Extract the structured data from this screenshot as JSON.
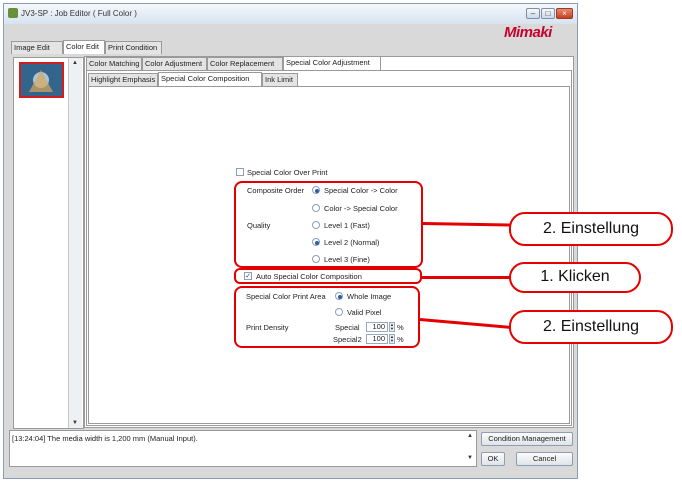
{
  "window": {
    "title": "JV3-SP : Job Editor ( Full Color )",
    "controls": [
      "–",
      "□",
      "×"
    ]
  },
  "logo": "Mimaki",
  "main_tabs": [
    {
      "label": "Image Edit"
    },
    {
      "label": "Color Edit"
    },
    {
      "label": "Print Condition"
    }
  ],
  "sub_tabs": [
    {
      "label": "Color Matching"
    },
    {
      "label": "Color Adjustment"
    },
    {
      "label": "Color Replacement"
    },
    {
      "label": "Special Color Adjustment"
    }
  ],
  "inner_tabs": [
    {
      "label": "Highlight Emphasis"
    },
    {
      "label": "Special Color Composition"
    },
    {
      "label": "Ink Limit"
    }
  ],
  "form": {
    "over_print": {
      "label": "Special Color Over Print",
      "checked": false
    },
    "composite_order": {
      "label": "Composite Order",
      "options": [
        "Special Color -> Color",
        "Color -> Special Color"
      ],
      "selected": "Special Color -> Color"
    },
    "quality": {
      "label": "Quality",
      "options": [
        "Level 1 (Fast)",
        "Level 2 (Normal)",
        "Level 3 (Fine)"
      ],
      "selected": "Level 2 (Normal)"
    },
    "auto_composition": {
      "label": "Auto Special Color Composition",
      "checked": true
    },
    "print_area": {
      "label": "Special Color Print Area",
      "options": [
        "Whole Image",
        "Valid Pixel"
      ],
      "selected": "Whole Image"
    },
    "print_density": {
      "label": "Print Density",
      "special": {
        "label": "Special",
        "value": "100",
        "unit": "%"
      },
      "special2": {
        "label": "Special2",
        "value": "100",
        "unit": "%"
      }
    }
  },
  "log": "[13:24:04] The media width is 1,200 mm (Manual Input).",
  "buttons": {
    "condition_management": "Condition Management",
    "ok": "OK",
    "cancel": "Cancel"
  },
  "callouts": [
    "2. Einstellung",
    "1. Klicken",
    "2. Einstellung"
  ],
  "colors": {
    "annotation": "#e50000",
    "logo": "#c8002d"
  }
}
